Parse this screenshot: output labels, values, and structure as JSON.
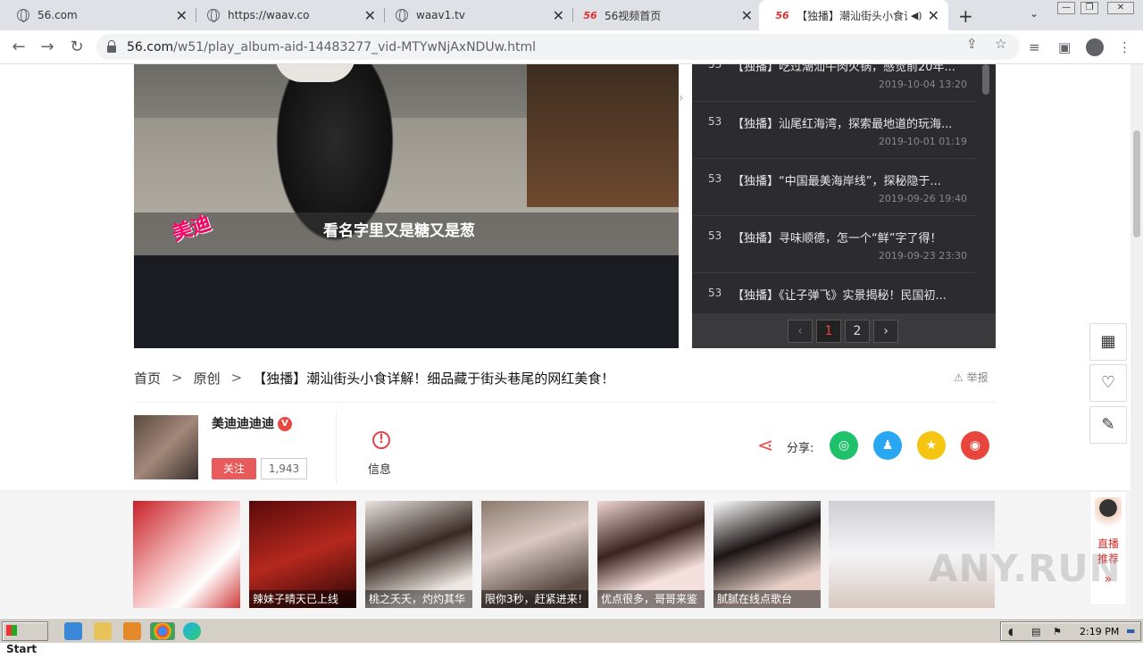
{
  "browser": {
    "tabs": [
      {
        "title": "56.com",
        "favicon": "globe-icon"
      },
      {
        "title": "https://waav.co",
        "favicon": "globe-icon"
      },
      {
        "title": "waav1.tv",
        "favicon": "globe-icon"
      },
      {
        "title": "56视频首页",
        "favicon": "56-logo"
      },
      {
        "title": "【独播】潮汕街头小食详解",
        "favicon": "56-logo",
        "active": true
      }
    ],
    "url_host": "56.com",
    "url_path": "/w51/play_album-aid-14483277_vid-MTYwNjAxNDUw.html"
  },
  "video": {
    "subtitle": "看名字里又是糖又是葱",
    "watermark": "美迪"
  },
  "playlist": {
    "items": [
      {
        "num": "53",
        "title": "【独播】吃过潮汕牛肉火锅，感觉前20年...",
        "date": "2019-10-04 13:20"
      },
      {
        "num": "53",
        "title": "【独播】汕尾红海湾，探索最地道的玩海...",
        "date": "2019-10-01 01:19"
      },
      {
        "num": "53",
        "title": "【独播】“中国最美海岸线”，探秘隐于...",
        "date": "2019-09-26 19:40"
      },
      {
        "num": "53",
        "title": "【独播】寻味顺德，怎一个“鲜”字了得！",
        "date": "2019-09-23 23:30"
      },
      {
        "num": "53",
        "title": "【独播】《让子弹飞》实景揭秘！民国初...",
        "date": ""
      }
    ],
    "pages": [
      "1",
      "2"
    ],
    "prev": "‹",
    "next": "›"
  },
  "breadcrumb": {
    "home": "首页",
    "category": "原创",
    "title": "【独播】潮汕街头小食详解！细品藏于街头巷尾的网红美食！",
    "sep": ">"
  },
  "report_label": "举报",
  "uploader": {
    "name": "美迪迪迪迪",
    "badge": "V",
    "follow_label": "关注",
    "followers": "1,943"
  },
  "info_label": "信息",
  "share": {
    "label": "分享:"
  },
  "recommend": [
    {
      "caption": ""
    },
    {
      "caption": "辣妹子晴天已上线"
    },
    {
      "caption": "桃之夭夭，灼灼其华"
    },
    {
      "caption": "限你3秒，赶紧进来！"
    },
    {
      "caption": "优点很多，哥哥来鉴"
    },
    {
      "caption": "腻腻在线点歌台"
    },
    {
      "caption": ""
    }
  ],
  "live": {
    "label1": "直播",
    "label2": "推荐"
  },
  "watermark_brand": "ANY.RUN",
  "taskbar": {
    "start_label": "Start",
    "clock": "2:19 PM"
  },
  "colors": {
    "accent": "#e95b5b",
    "wechat": "#1fc16b",
    "qq": "#2aa7f2",
    "qzone": "#f5c512",
    "weibo": "#e8453c"
  }
}
